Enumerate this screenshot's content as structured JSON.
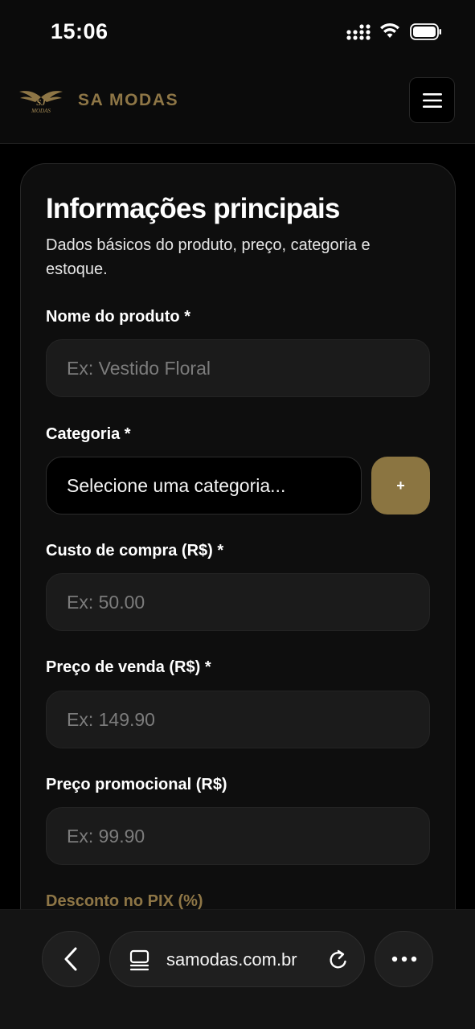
{
  "status_bar": {
    "time": "15:06",
    "icons": [
      "cellular-signal-icon",
      "wifi-icon",
      "battery-icon"
    ]
  },
  "header": {
    "brand": "SA MODAS",
    "logo_icon": "winged-sa-modas-logo",
    "menu_icon": "hamburger-menu-icon"
  },
  "form": {
    "title": "Informações principais",
    "subtitle": "Dados básicos do produto, preço, categoria e estoque.",
    "fields": {
      "name": {
        "label": "Nome do produto *",
        "placeholder": "Ex: Vestido Floral"
      },
      "category": {
        "label": "Categoria *",
        "value": "Selecione uma categoria...",
        "add_label": "+"
      },
      "cost": {
        "label": "Custo de compra (R$) *",
        "placeholder": "Ex: 50.00"
      },
      "price": {
        "label": "Preço de venda (R$) *",
        "placeholder": "Ex: 149.90"
      },
      "promo": {
        "label": "Preço promocional (R$)",
        "placeholder": "Ex: 99.90"
      },
      "pix": {
        "label": "Desconto no PIX (%)"
      }
    }
  },
  "browser": {
    "url": "samodas.com.br",
    "icons": [
      "back-arrow-icon",
      "tab-layout-icon",
      "reload-icon",
      "more-dots-icon"
    ]
  },
  "colors": {
    "accent_gold": "#8b7541",
    "brand_gold": "#8e7646",
    "background": "#000000",
    "card": "#0e0e0e",
    "input": "#1b1b1b"
  }
}
